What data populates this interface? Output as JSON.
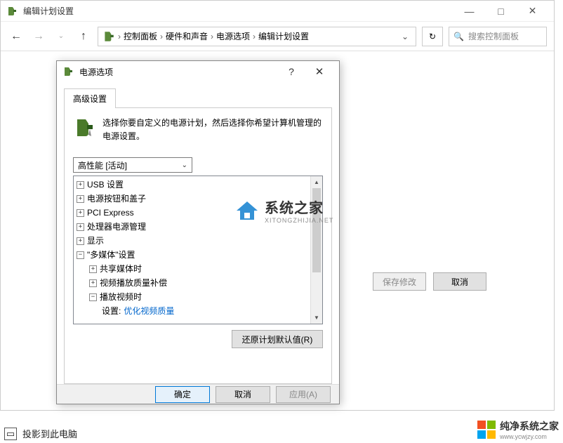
{
  "window": {
    "title": "编辑计划设置",
    "minimize": "—",
    "maximize": "□",
    "close": "✕"
  },
  "toolbar": {
    "breadcrumb": [
      "控制面板",
      "硬件和声音",
      "电源选项",
      "编辑计划设置"
    ],
    "search_placeholder": "搜索控制面板"
  },
  "page_actions": {
    "save": "保存修改",
    "cancel": "取消"
  },
  "dialog": {
    "title": "电源选项",
    "tab": "高级设置",
    "description": "选择你要自定义的电源计划，然后选择你希望计算机管理的电源设置。",
    "plan_selected": "高性能 [活动]",
    "tree": {
      "n0": "USB 设置",
      "n1": "电源按钮和盖子",
      "n2": "PCI Express",
      "n3": "处理器电源管理",
      "n4": "显示",
      "n5": "\"多媒体\"设置",
      "n5_0": "共享媒体时",
      "n5_1": "视频播放质量补偿",
      "n5_2": "播放视频时",
      "n5_2_setting_label": "设置:",
      "n5_2_setting_value": "优化视频质量"
    },
    "restore": "还原计划默认值(R)",
    "ok": "确定",
    "cancel": "取消",
    "apply": "应用(A)"
  },
  "taskbar": {
    "project": "投影到此电脑"
  },
  "watermark1": {
    "text": "系统之家",
    "sub": "XITONGZHIJIA.NET"
  },
  "watermark2": {
    "text": "纯净系统之家",
    "sub": "www.ycwjzy.com"
  }
}
